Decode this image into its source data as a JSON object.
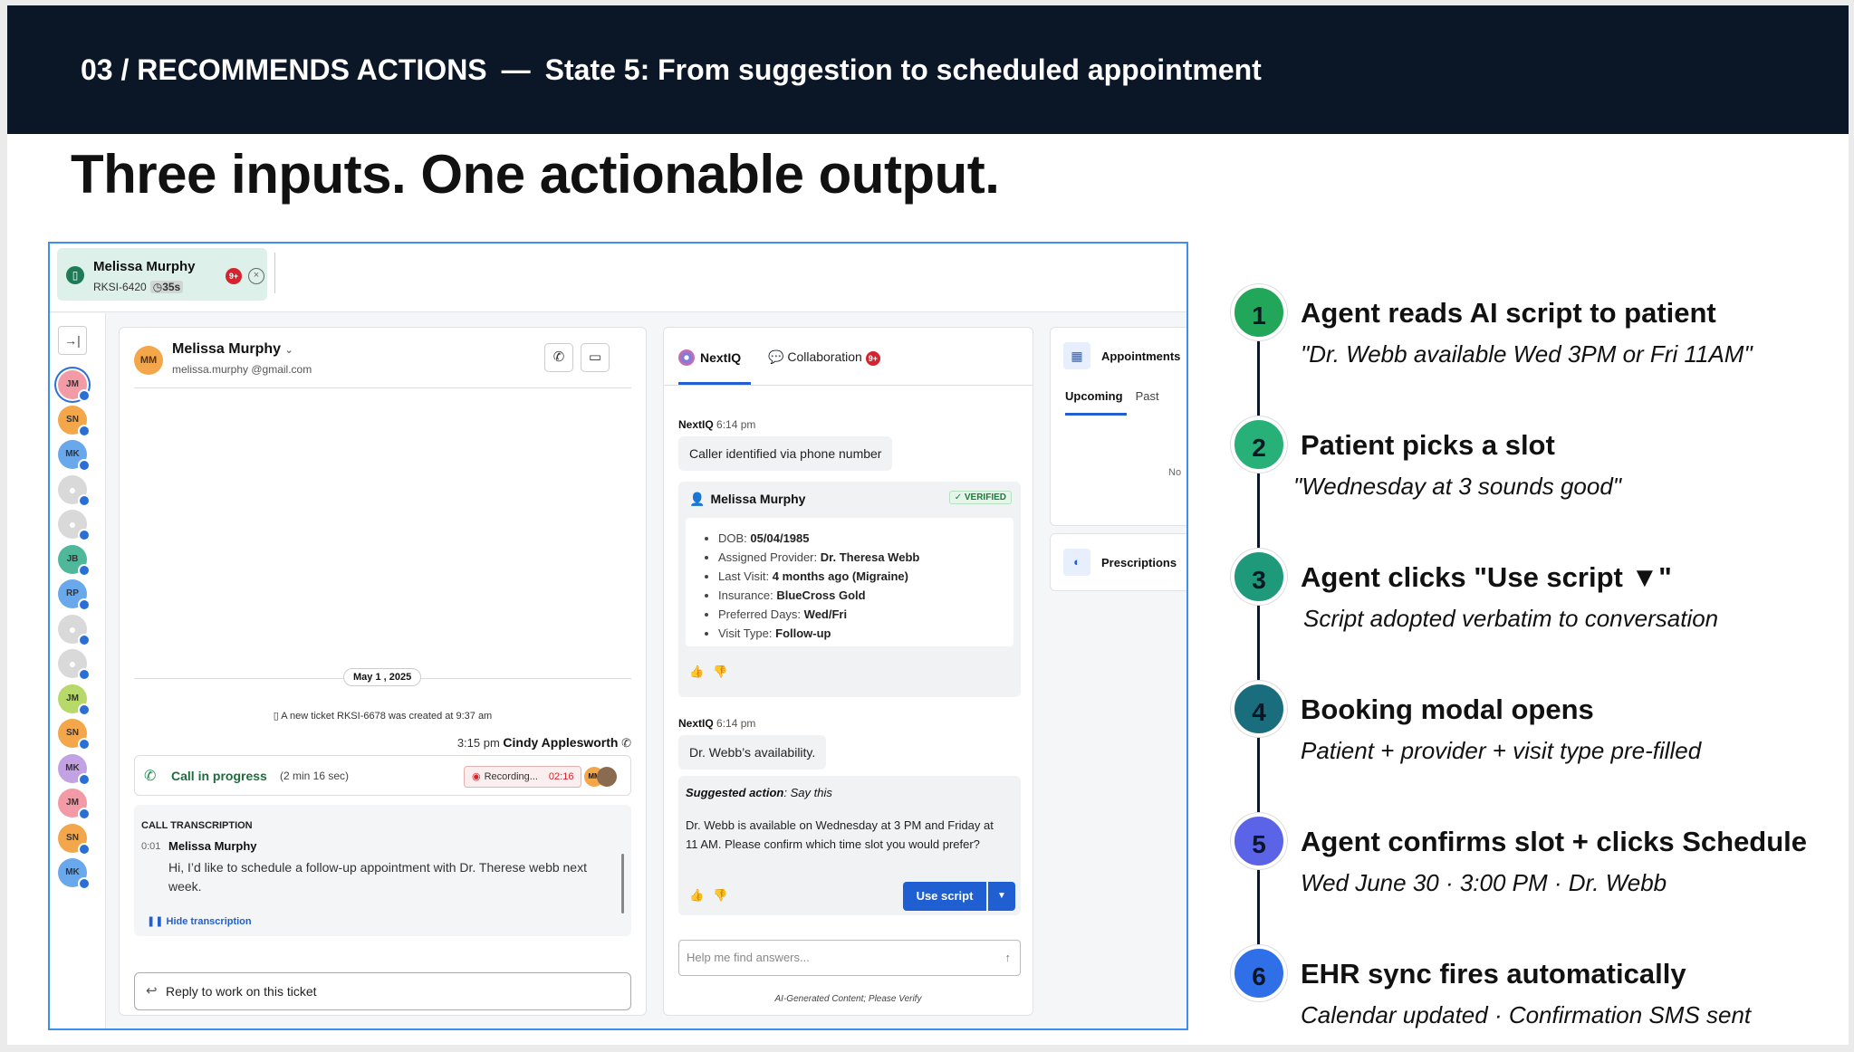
{
  "header": {
    "section": "03 / RECOMMENDS ACTIONS",
    "separator": "—",
    "state": "State 5: From suggestion to scheduled appointment"
  },
  "headline": "Three inputs. One actionable output.",
  "ticket_tab": {
    "name": "Melissa Murphy",
    "ticket_id": "RKSI-6420",
    "timer": "35s",
    "badge": "9+"
  },
  "rail": {
    "avatars": [
      {
        "initials": "JM",
        "color": "#f29aa5"
      },
      {
        "initials": "SN",
        "color": "#f4a64a"
      },
      {
        "initials": "MK",
        "color": "#6aa8ec"
      },
      {
        "initials": "",
        "color": "#d9d9d9"
      },
      {
        "initials": "",
        "color": "#d9d9d9"
      },
      {
        "initials": "JB",
        "color": "#4fb89a"
      },
      {
        "initials": "RP",
        "color": "#6aa8ec"
      },
      {
        "initials": "",
        "color": "#d9d9d9"
      },
      {
        "initials": "",
        "color": "#d9d9d9"
      },
      {
        "initials": "JM",
        "color": "#b6d96a"
      },
      {
        "initials": "SN",
        "color": "#f4a64a"
      },
      {
        "initials": "MK",
        "color": "#c2a2e2"
      },
      {
        "initials": "JM",
        "color": "#f29aa5"
      },
      {
        "initials": "SN",
        "color": "#f4a64a"
      },
      {
        "initials": "MK",
        "color": "#6aa8ec"
      }
    ]
  },
  "conversation": {
    "contact_initials": "MM",
    "contact_name": "Melissa Murphy",
    "contact_email": "melissa.murphy @gmail.com",
    "date": "May 1 , 2025",
    "system_msg": "A new ticket RKSI-6678 was created at 9:37 am",
    "agent_time": "3:15 pm",
    "agent_name": "Cindy Applesworth",
    "call_status": "Call in progress",
    "call_duration": "(2 min 16 sec)",
    "recording_label": "Recording...",
    "recording_time": "02:16",
    "avatar_initials": "MM",
    "transcript_header": "CALL TRANSCRIPTION",
    "transcript_time": "0:01",
    "transcript_speaker": "Melissa Murphy",
    "transcript_text": "Hi, I’d like to schedule a follow-up appointment with Dr. Therese webb next week.",
    "hide_transcription": "Hide transcription",
    "reply_placeholder": "Reply to work on this ticket"
  },
  "nextiq": {
    "tab_nextiq": "NextIQ",
    "tab_collab": "Collaboration",
    "collab_badge": "9+",
    "msg1_sender": "NextIQ",
    "msg1_time": "6:14 pm",
    "msg1_text": "Caller identified via phone number",
    "patient_name": "Melissa Murphy",
    "verified": "VERIFIED",
    "details": [
      {
        "label": "DOB:",
        "value": "05/04/1985"
      },
      {
        "label": "Assigned Provider:",
        "value": "Dr. Theresa Webb"
      },
      {
        "label": "Last Visit:",
        "value": "4 months ago (Migraine)"
      },
      {
        "label": "Insurance:",
        "value": "BlueCross Gold"
      },
      {
        "label": "Preferred Days:",
        "value": "Wed/Fri"
      },
      {
        "label": "Visit Type:",
        "value": "Follow-up"
      }
    ],
    "msg2_sender": "NextIQ",
    "msg2_time": "6:14 pm",
    "msg2_text": "Dr. Webb’s availability.",
    "suggested_label": "Suggested action",
    "suggested_rest": ": Say this",
    "suggested_text": "Dr. Webb is available on Wednesday at 3 PM and Friday at 11 AM. Please confirm which time slot you would prefer?",
    "use_script": "Use script",
    "ask_placeholder": "Help me find answers...",
    "ai_disclaimer": "AI-Generated Content; Please Verify"
  },
  "appointments": {
    "title": "Appointments",
    "tab_upcoming": "Upcoming",
    "tab_past": "Past",
    "empty": "No"
  },
  "prescriptions": {
    "title": "Prescriptions"
  },
  "steps": [
    {
      "num": "1",
      "title": "Agent reads AI script to patient",
      "sub": "\"Dr. Webb available Wed 3PM or Fri 11AM\"",
      "color": "#22a65a"
    },
    {
      "num": "2",
      "title": "Patient picks a slot",
      "sub": "\"Wednesday at 3 sounds good\"",
      "color": "#27b077"
    },
    {
      "num": "3",
      "title": "Agent clicks \"Use script ▼\"",
      "sub": "Script adopted verbatim to conversation",
      "color": "#1e9a7a"
    },
    {
      "num": "4",
      "title": "Booking modal opens",
      "sub": "Patient + provider + visit type pre-filled",
      "color": "#1a6d7c"
    },
    {
      "num": "5",
      "title": "Agent confirms slot + clicks Schedule",
      "sub": "Wed June 30 · 3:00 PM · Dr. Webb",
      "color": "#5b63e6"
    },
    {
      "num": "6",
      "title": " EHR sync fires automatically",
      "sub": "Calendar updated · Confirmation SMS sent",
      "color": "#2f6fe8"
    }
  ]
}
